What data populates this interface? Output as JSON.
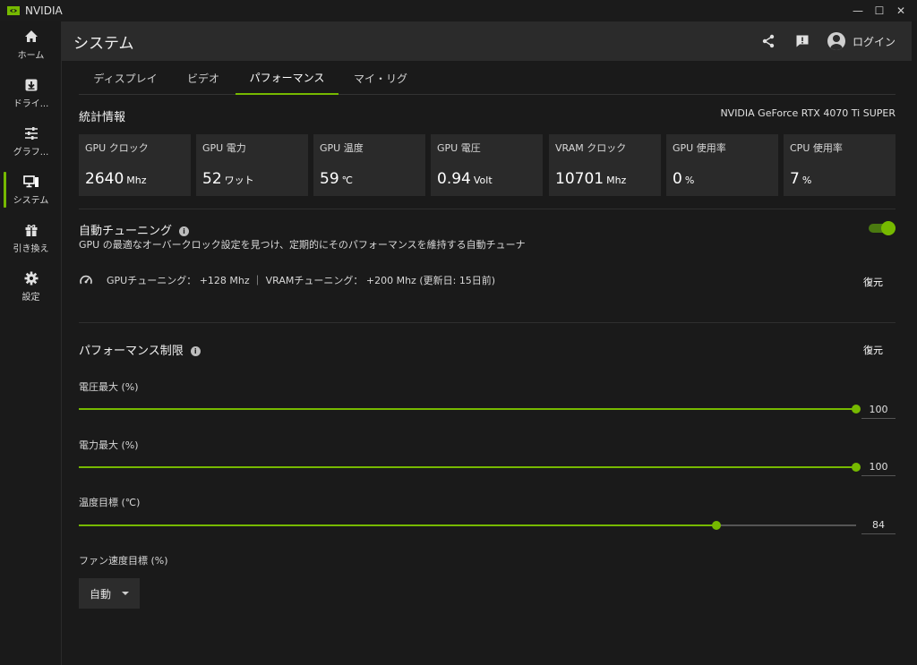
{
  "app": {
    "name": "NVIDIA",
    "accent": "#76b900"
  },
  "window_controls": {
    "minimize": "—",
    "maximize": "☐",
    "close": "✕"
  },
  "sidebar": {
    "items": [
      {
        "label": "ホーム",
        "icon": "home-icon"
      },
      {
        "label": "ドライ...",
        "icon": "download-icon"
      },
      {
        "label": "グラフ...",
        "icon": "sliders-icon"
      },
      {
        "label": "システム",
        "icon": "system-icon",
        "active": true
      },
      {
        "label": "引き換え",
        "icon": "gift-icon"
      },
      {
        "label": "設定",
        "icon": "gear-icon"
      }
    ]
  },
  "header": {
    "title": "システム",
    "login_label": "ログイン"
  },
  "tabs": [
    {
      "label": "ディスプレイ"
    },
    {
      "label": "ビデオ"
    },
    {
      "label": "パフォーマンス",
      "active": true
    },
    {
      "label": "マイ・リグ"
    }
  ],
  "stats": {
    "title": "統計情報",
    "gpu_name": "NVIDIA GeForce RTX 4070 Ti SUPER",
    "cards": [
      {
        "label": "GPU クロック",
        "value": "2640",
        "unit": "Mhz"
      },
      {
        "label": "GPU 電力",
        "value": "52",
        "unit": "ワット"
      },
      {
        "label": "GPU 温度",
        "value": "59",
        "unit": "℃"
      },
      {
        "label": "GPU 電圧",
        "value": "0.94",
        "unit": "Volt"
      },
      {
        "label": "VRAM クロック",
        "value": "10701",
        "unit": "Mhz"
      },
      {
        "label": "GPU 使用率",
        "value": "0",
        "unit": "%"
      },
      {
        "label": "CPU 使用率",
        "value": "7",
        "unit": "%"
      }
    ]
  },
  "auto_tuning": {
    "title": "自動チューニング",
    "description": "GPU の最適なオーバークロック設定を見つけ、定期的にそのパフォーマンスを維持する自動チューナ",
    "enabled": true,
    "status": "GPUチューニング： +128 Mhz ｜ VRAMチューニング： +200 Mhz (更新日: 15日前)",
    "restore_label": "復元"
  },
  "performance_limits": {
    "title": "パフォーマンス制限",
    "restore_label": "復元",
    "sliders": [
      {
        "label": "電圧最大 (%)",
        "value": "100",
        "fraction": 1.0
      },
      {
        "label": "電力最大 (%)",
        "value": "100",
        "fraction": 1.0
      },
      {
        "label": "温度目標 (℃)",
        "value": "84",
        "fraction": 0.82
      }
    ],
    "fan": {
      "label": "ファン速度目標 (%)",
      "selected": "自動"
    }
  }
}
